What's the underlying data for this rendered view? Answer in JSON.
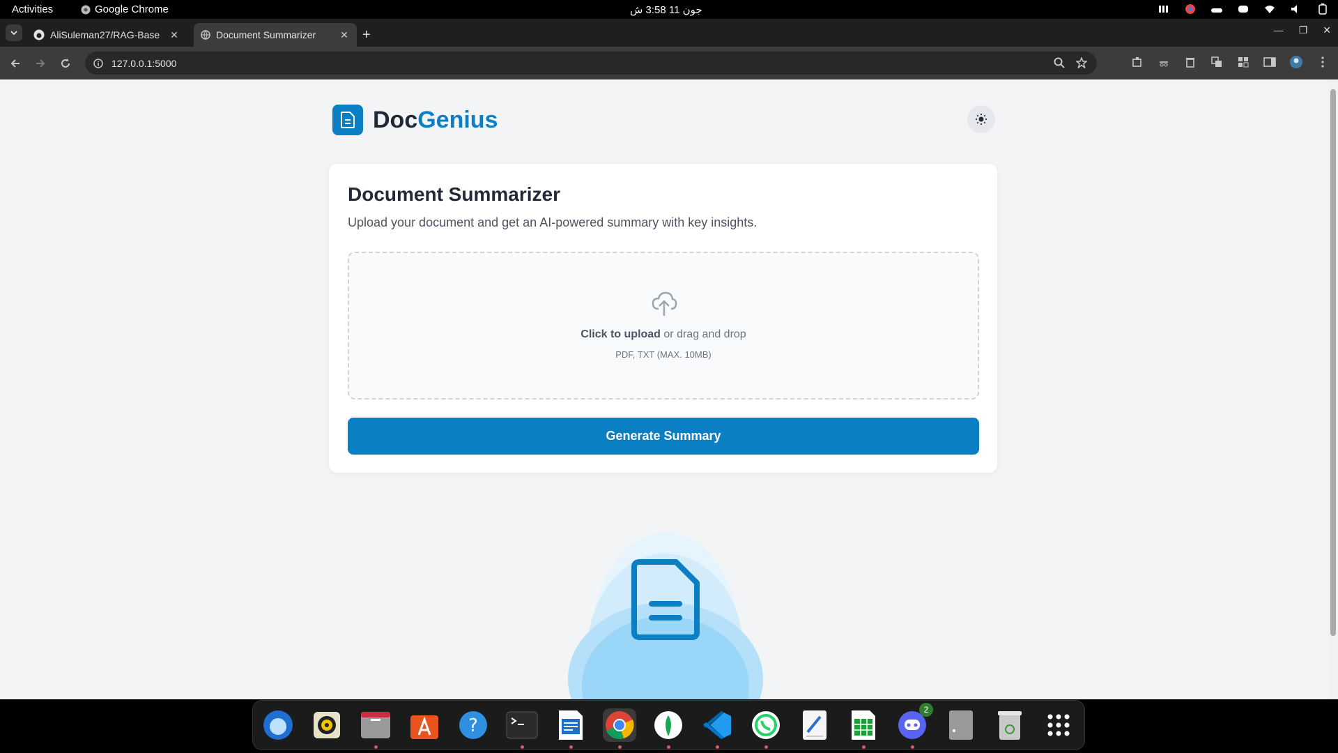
{
  "system": {
    "activities": "Activities",
    "app_name": "Google Chrome",
    "clock": "جون 11  3:58 ش"
  },
  "browser": {
    "tabs": [
      {
        "title": "AliSuleman27/RAG-Base",
        "icon": "github-icon"
      },
      {
        "title": "Document Summarizer",
        "icon": "globe-icon"
      }
    ],
    "url": "127.0.0.1:5000"
  },
  "page": {
    "brand_prefix": "Doc",
    "brand_accent": "Genius",
    "card": {
      "title": "Document Summarizer",
      "subtitle": "Upload your document and get an AI-powered summary with key insights.",
      "upload_strong": "Click to upload",
      "upload_rest": " or drag and drop",
      "upload_hint": "PDF, TXT (MAX. 10MB)",
      "button": "Generate Summary"
    }
  },
  "dock": {
    "discord_badge": "2",
    "apps": [
      "thunderbird-icon",
      "rhythmbox-icon",
      "files-icon",
      "app-center-icon",
      "help-icon",
      "terminal-icon",
      "writer-icon",
      "chrome-icon",
      "mongodb-compass-icon",
      "vscode-icon",
      "whatsapp-icon",
      "text-editor-icon",
      "calc-icon",
      "discord-icon",
      "drive-icon",
      "trash-icon",
      "app-grid-icon"
    ]
  },
  "colors": {
    "accent": "#0b7fc4",
    "background": "#f3f4f6"
  }
}
